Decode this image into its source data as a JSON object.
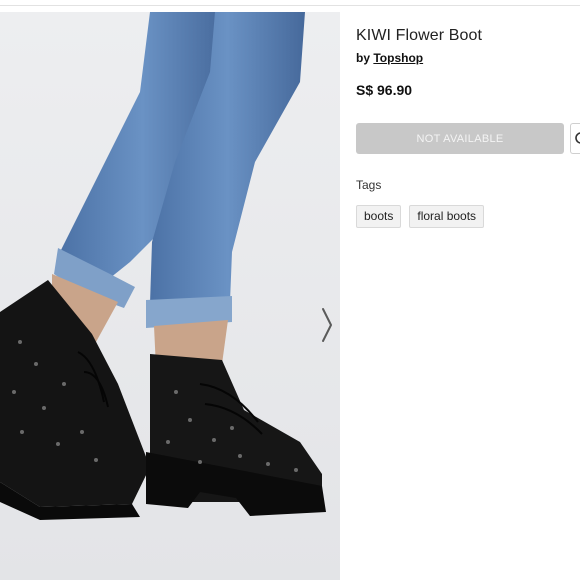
{
  "product": {
    "title": "KIWI Flower Boot",
    "by_prefix": "by",
    "brand": "Topshop",
    "price": "S$ 96.90"
  },
  "actions": {
    "availability_label": "NOT AVAILABLE"
  },
  "tags": {
    "heading": "Tags",
    "items": [
      {
        "label": "boots"
      },
      {
        "label": "floral boots"
      }
    ]
  },
  "gallery": {
    "next_icon": "chevron-right-icon",
    "photo_background": "#e9eaec",
    "denim_color": "#5b82b5",
    "boot_color": "#141414"
  },
  "colors": {
    "button_disabled": "#c8c8c8",
    "tag_background": "#f2f2f2",
    "text": "#222222"
  }
}
